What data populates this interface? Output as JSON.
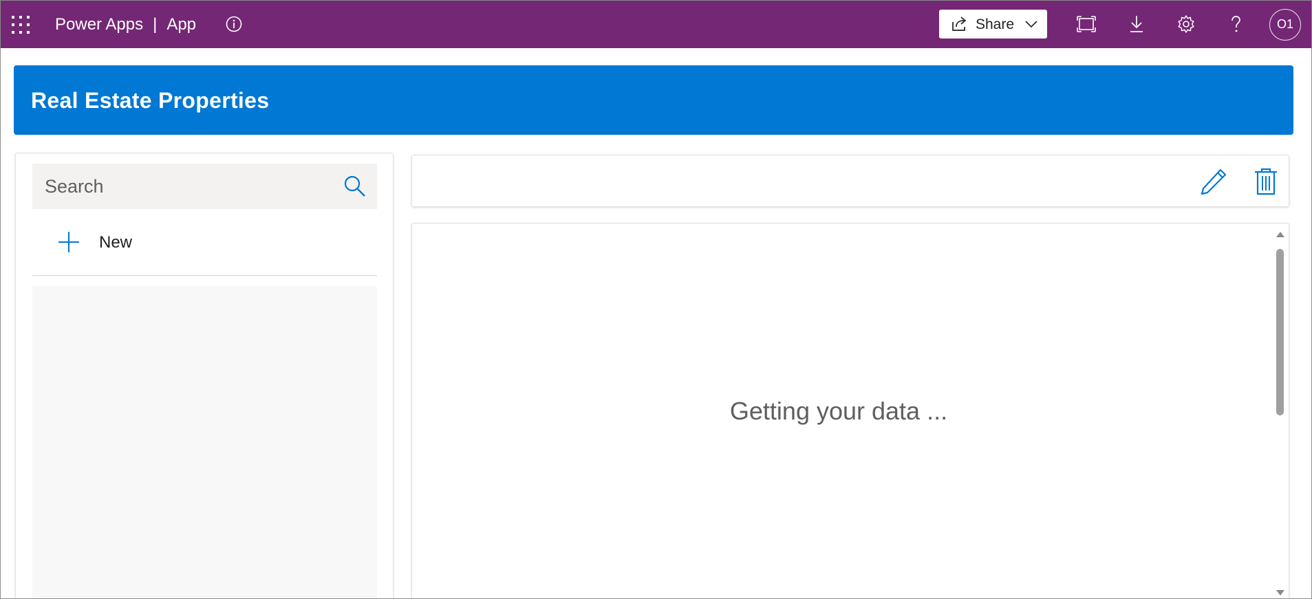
{
  "topbar": {
    "app_label": "Power Apps",
    "separator": "|",
    "page_label": "App",
    "share_label": "Share",
    "avatar_initials": "O1",
    "colors": {
      "background": "#742774",
      "text": "#ffffff"
    },
    "icons": [
      "app-launcher-icon",
      "info-icon",
      "share-icon",
      "chevron-down-icon",
      "fit-to-window-icon",
      "download-icon",
      "settings-icon",
      "help-icon"
    ]
  },
  "header": {
    "title": "Real Estate Properties",
    "color": "#0078d4"
  },
  "sidebar": {
    "search_placeholder": "Search",
    "search_value": "",
    "new_label": "New",
    "accent": "#0078d4"
  },
  "toolbar": {
    "icons": [
      "edit-icon",
      "delete-icon"
    ]
  },
  "detail": {
    "loading_text": "Getting your data ..."
  }
}
